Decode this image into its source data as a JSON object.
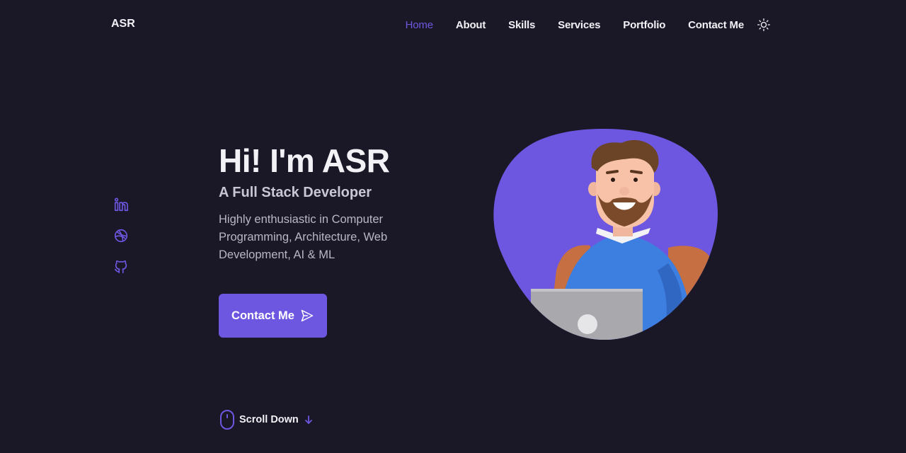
{
  "header": {
    "logo": "ASR",
    "nav": [
      {
        "label": "Home",
        "active": true
      },
      {
        "label": "About",
        "active": false
      },
      {
        "label": "Skills",
        "active": false
      },
      {
        "label": "Services",
        "active": false
      },
      {
        "label": "Portfolio",
        "active": false
      },
      {
        "label": "Contact Me",
        "active": false
      }
    ],
    "theme_icon": "sun-icon"
  },
  "socials": [
    {
      "icon": "linkedin-icon"
    },
    {
      "icon": "dribbble-icon"
    },
    {
      "icon": "github-icon"
    }
  ],
  "hero": {
    "title": "Hi! I'm ASR",
    "subtitle": "A Full Stack Developer",
    "description": "Highly enthusiastic in Computer Programming, Architecture, Web Development, AI & ML",
    "button_label": "Contact Me",
    "button_icon": "send-icon",
    "illustration": "developer-avatar-illustration"
  },
  "scroll": {
    "label": "Scroll Down",
    "mouse_icon": "mouse-icon",
    "arrow_icon": "arrow-down-icon"
  },
  "colors": {
    "background": "#1a1726",
    "accent": "#6e57e0",
    "text": "#f2f1f6",
    "muted": "#bab6c8"
  }
}
